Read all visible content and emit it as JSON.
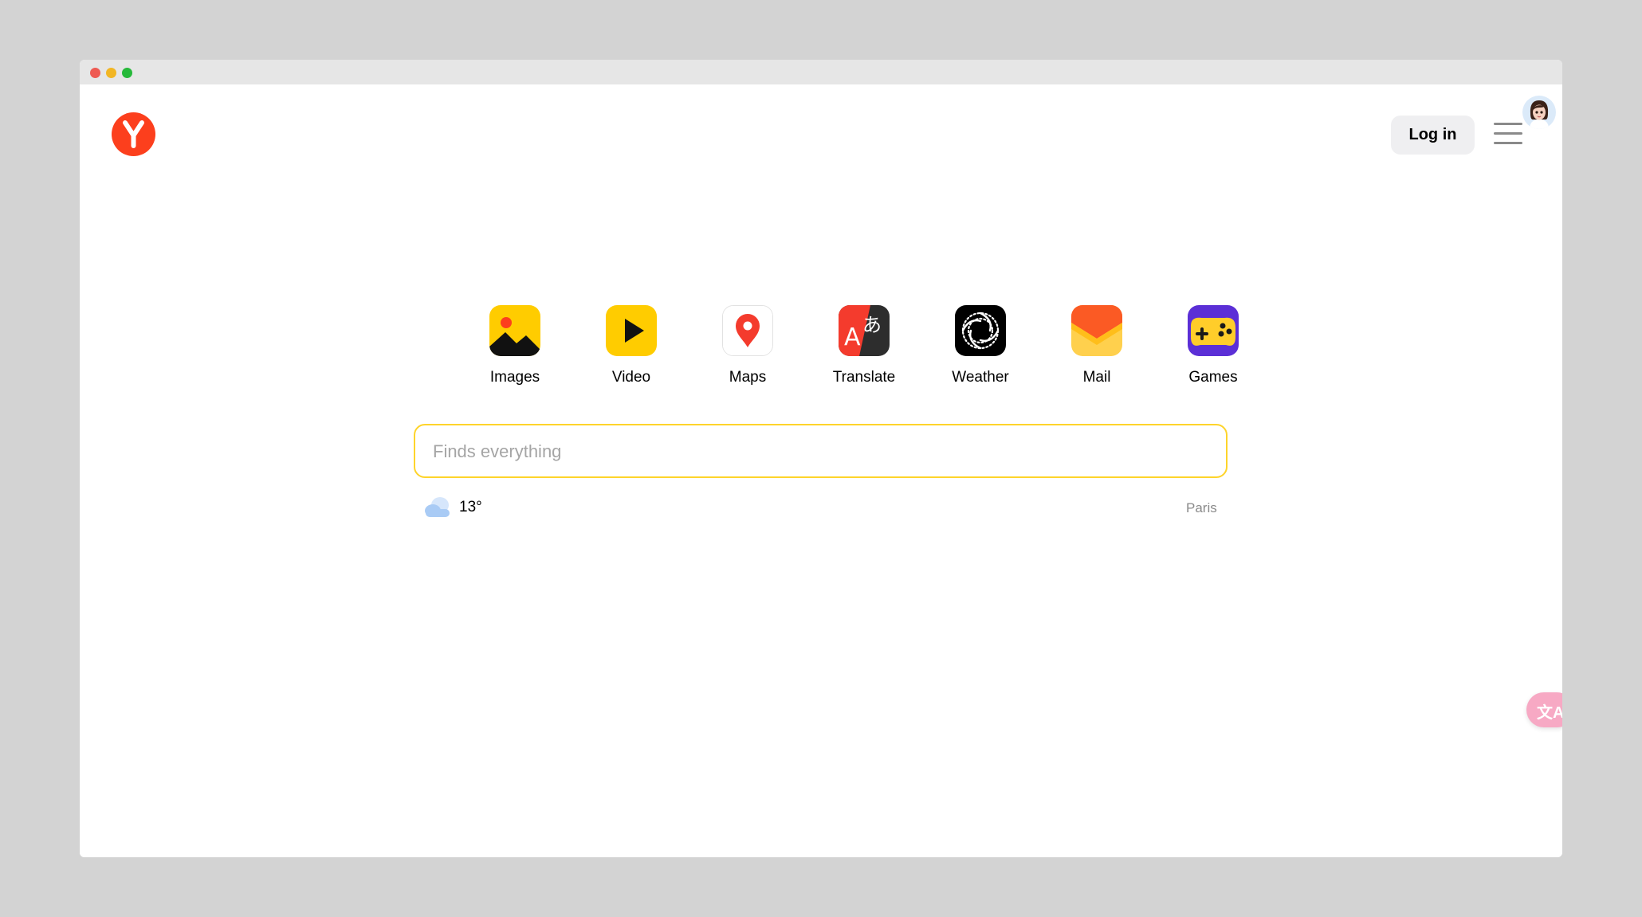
{
  "window": {
    "traffic_lights": [
      "close",
      "minimize",
      "maximize"
    ]
  },
  "header": {
    "logo_letter": "Y",
    "login_label": "Log in",
    "menu_icon": "hamburger-menu-icon",
    "avatar_icon": "user-avatar-icon"
  },
  "services": [
    {
      "label": "Images",
      "icon": "images-icon"
    },
    {
      "label": "Video",
      "icon": "video-icon"
    },
    {
      "label": "Maps",
      "icon": "maps-icon"
    },
    {
      "label": "Translate",
      "icon": "translate-icon"
    },
    {
      "label": "Weather",
      "icon": "weather-icon"
    },
    {
      "label": "Mail",
      "icon": "mail-icon"
    },
    {
      "label": "Games",
      "icon": "games-icon"
    }
  ],
  "search": {
    "placeholder": "Finds everything",
    "value": ""
  },
  "weather": {
    "temperature": "13°",
    "city": "Paris",
    "icon": "cloud-icon"
  },
  "colors": {
    "brand_red": "#fc3f1d",
    "search_border": "#fed42b",
    "login_bg": "#efeff1"
  }
}
